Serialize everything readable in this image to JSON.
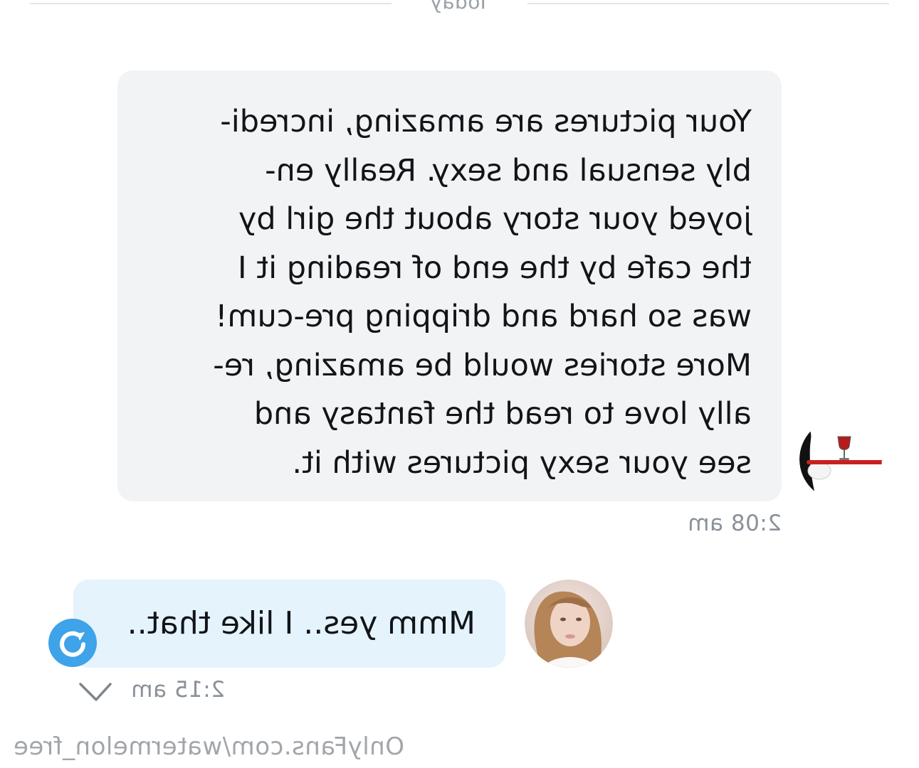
{
  "date_divider": "Today",
  "incoming_message": {
    "lines": [
      "Your pictures are amazing, incredi-",
      "bly sensual and sexy. Really en-",
      "joyed your story about the girl by",
      "the cafe by the end of reading it I",
      "was so hard and dripping pre-cum!",
      "More stories would be amazing, re-",
      "ally love to read the fantasy and",
      "see your sexy pictures with it."
    ],
    "time": "2:08 am",
    "avatar_icon": "wine-glass-tray-avatar"
  },
  "outgoing_message": {
    "text": "Mmm yes.. I like that..",
    "time": "2:15 am",
    "status_icon": "double-check-icon",
    "badge_icon": "tip-refresh-icon",
    "badge_color": "#3ea3e8",
    "avatar_icon": "creator-photo-avatar"
  },
  "watermark": "OnlyFans.com/watermelon_free",
  "colors": {
    "incoming_bubble": "#f2f3f5",
    "outgoing_bubble": "#e4f3fc",
    "timestamp": "#8a9199"
  }
}
